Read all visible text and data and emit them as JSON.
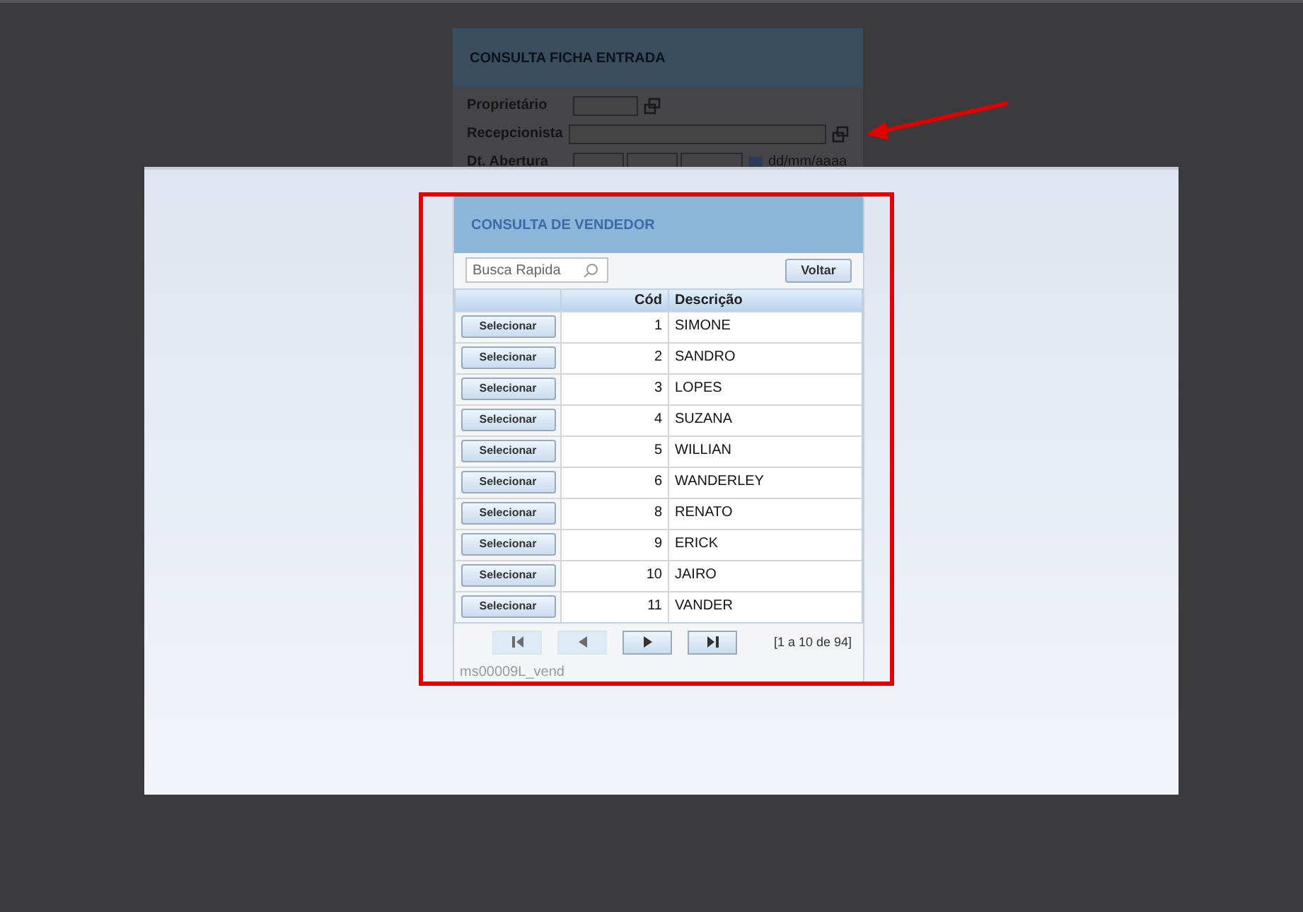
{
  "background_form": {
    "title": "CONSULTA FICHA ENTRADA",
    "fields": [
      {
        "label": "Proprietário",
        "kind": "short"
      },
      {
        "label": "Recepcionista",
        "kind": "long"
      },
      {
        "label": "Dt. Abertura",
        "kind": "date",
        "hint": "dd/mm/aaaa"
      }
    ]
  },
  "dialog": {
    "title": "CONSULTA DE VENDEDOR",
    "search": {
      "placeholder": "Busca Rapida"
    },
    "back_button": "Voltar",
    "table": {
      "columns": [
        "Cód",
        "Descrição"
      ],
      "rows": [
        {
          "action": "Selecionar",
          "code": "1",
          "name": "SIMONE"
        },
        {
          "action": "Selecionar",
          "code": "2",
          "name": "SANDRO"
        },
        {
          "action": "Selecionar",
          "code": "3",
          "name": "LOPES"
        },
        {
          "action": "Selecionar",
          "code": "4",
          "name": "SUZANA"
        },
        {
          "action": "Selecionar",
          "code": "5",
          "name": "WILLIAN"
        },
        {
          "action": "Selecionar",
          "code": "6",
          "name": "WANDERLEY"
        },
        {
          "action": "Selecionar",
          "code": "8",
          "name": "RENATO"
        },
        {
          "action": "Selecionar",
          "code": "9",
          "name": "ERICK"
        },
        {
          "action": "Selecionar",
          "code": "10",
          "name": "JAIRO"
        },
        {
          "action": "Selecionar",
          "code": "11",
          "name": "VANDER"
        }
      ]
    },
    "pager": {
      "buttons": [
        {
          "kind": "first",
          "disabled": true
        },
        {
          "kind": "prev",
          "disabled": true
        },
        {
          "kind": "next",
          "disabled": false
        },
        {
          "kind": "last",
          "disabled": false
        }
      ],
      "range": "[1 a 10 de 94]"
    },
    "footer": "ms00009L_vend"
  }
}
